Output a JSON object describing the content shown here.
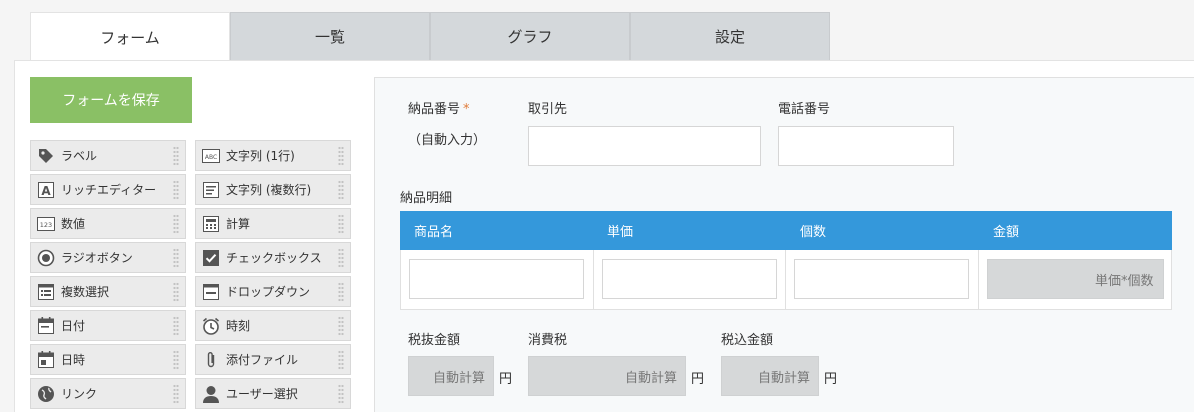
{
  "tabs": [
    {
      "label": "フォーム"
    },
    {
      "label": "一覧"
    },
    {
      "label": "グラフ"
    },
    {
      "label": "設定"
    }
  ],
  "save_button": "フォームを保存",
  "palette": [
    {
      "label": "ラベル",
      "icon": "tag-icon"
    },
    {
      "label": "文字列 (1行)",
      "icon": "text-field-icon"
    },
    {
      "label": "リッチエディター",
      "icon": "rich-editor-icon"
    },
    {
      "label": "文字列 (複数行)",
      "icon": "multiline-text-icon"
    },
    {
      "label": "数値",
      "icon": "number-icon"
    },
    {
      "label": "計算",
      "icon": "calculator-icon"
    },
    {
      "label": "ラジオボタン",
      "icon": "radio-icon"
    },
    {
      "label": "チェックボックス",
      "icon": "checkbox-icon"
    },
    {
      "label": "複数選択",
      "icon": "multi-select-icon"
    },
    {
      "label": "ドロップダウン",
      "icon": "dropdown-icon"
    },
    {
      "label": "日付",
      "icon": "calendar-icon"
    },
    {
      "label": "時刻",
      "icon": "clock-icon"
    },
    {
      "label": "日時",
      "icon": "datetime-icon"
    },
    {
      "label": "添付ファイル",
      "icon": "paperclip-icon"
    },
    {
      "label": "リンク",
      "icon": "globe-icon"
    },
    {
      "label": "ユーザー選択",
      "icon": "user-icon"
    }
  ],
  "form": {
    "delivery_no_label": "納品番号",
    "required_mark": "*",
    "delivery_no_value": "（自動入力）",
    "client_label": "取引先",
    "phone_label": "電話番号",
    "detail_label": "納品明細",
    "table_headers": [
      "商品名",
      "単価",
      "個数",
      "金額"
    ],
    "amount_formula": "単価*個数",
    "subtotal_label": "税抜金額",
    "tax_label": "消費税",
    "total_label": "税込金額",
    "auto_calc": "自動計算",
    "yen": "円"
  },
  "colors": {
    "save_button": "#8ac065",
    "table_header": "#3498db",
    "required": "#e07b39"
  }
}
